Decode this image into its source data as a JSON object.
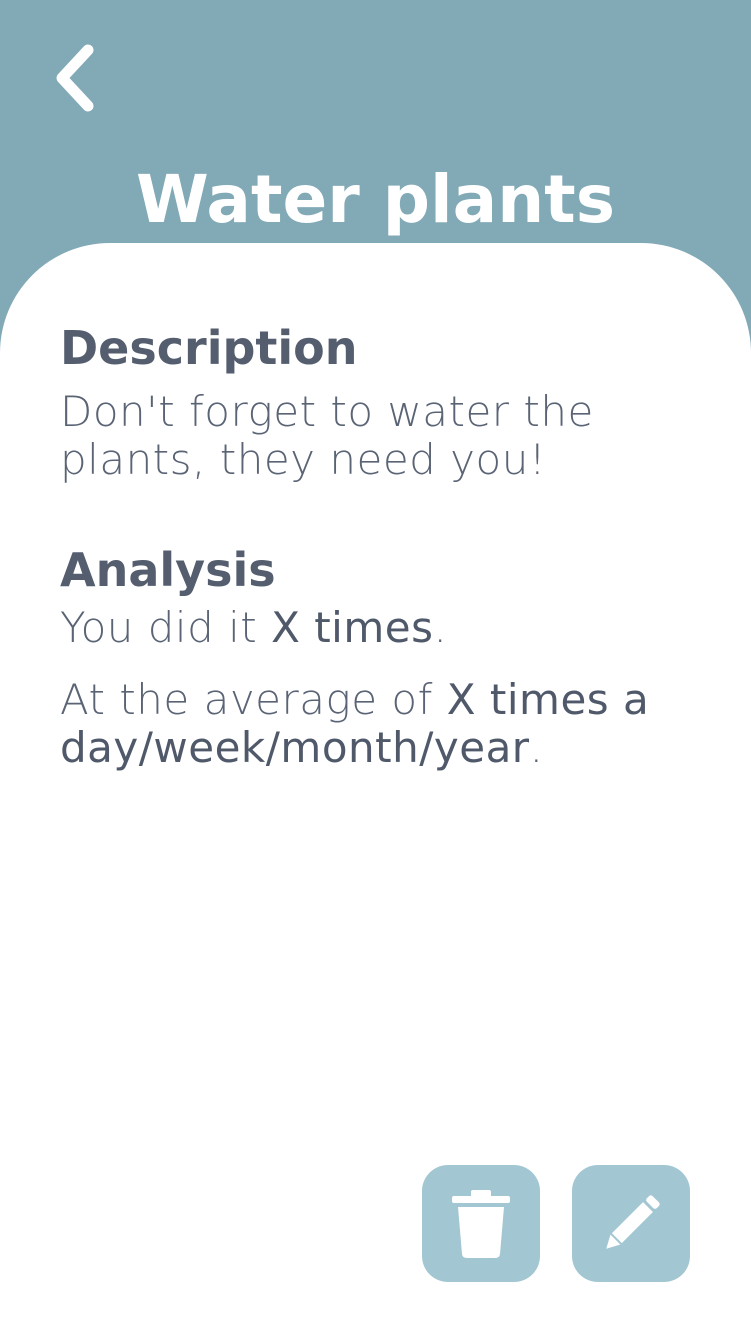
{
  "header": {
    "back_icon": "chevron-left-icon",
    "title": "Water plants"
  },
  "description": {
    "heading": "Description",
    "text": "Don't forget to water the plants, they need you!"
  },
  "analysis": {
    "heading": "Analysis",
    "line1_prefix": "You did it ",
    "line1_value": "X times",
    "line1_suffix": ".",
    "line2_prefix": "At the average of ",
    "line2_value": "X times a day/week/month/year",
    "line2_suffix": "."
  },
  "actions": {
    "delete_icon": "trash-icon",
    "edit_icon": "pencil-icon"
  },
  "colors": {
    "header_bg": "#81a9b6",
    "button_bg": "#a2c7d3",
    "text": "#545e6f",
    "sheet_bg": "#ffffff"
  }
}
